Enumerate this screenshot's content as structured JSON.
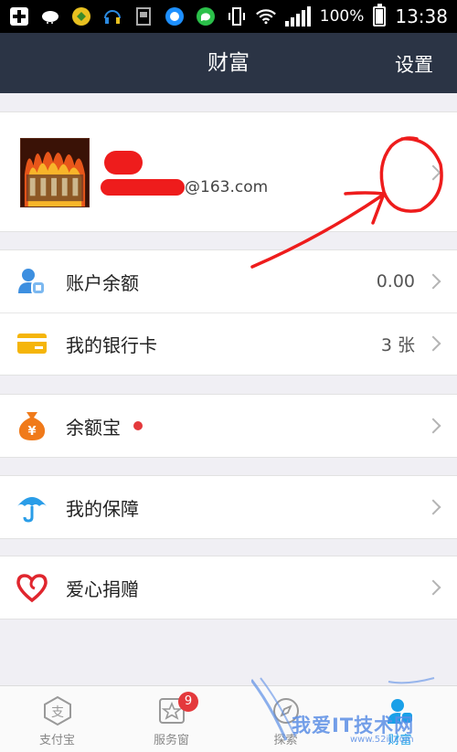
{
  "status_bar": {
    "battery": "100%",
    "time": "13:38",
    "icons": [
      "plus-icon",
      "cloud-icon",
      "shield-icon",
      "headset-icon",
      "sim-icon",
      "qq-browser-icon",
      "chat-icon",
      "vibrate-icon",
      "wifi-icon",
      "signal-icon",
      "battery-icon"
    ]
  },
  "header": {
    "title": "财富",
    "settings_label": "设置"
  },
  "profile": {
    "email_suffix": "@163.com"
  },
  "groups": [
    {
      "rows": [
        {
          "label": "账户余额",
          "value": "0.00",
          "icon": "account-balance-icon"
        },
        {
          "label": "我的银行卡",
          "value": "3 张",
          "icon": "bank-card-icon"
        }
      ]
    },
    {
      "rows": [
        {
          "label": "余额宝",
          "value": "",
          "icon": "money-bag-icon",
          "dot": true
        }
      ]
    },
    {
      "rows": [
        {
          "label": "我的保障",
          "value": "",
          "icon": "umbrella-icon"
        }
      ]
    },
    {
      "rows": [
        {
          "label": "爱心捐赠",
          "value": "",
          "icon": "heart-icon"
        }
      ]
    }
  ],
  "tabs": [
    {
      "label": "支付宝",
      "icon": "alipay-icon"
    },
    {
      "label": "服务窗",
      "icon": "service-window-icon",
      "badge": "9"
    },
    {
      "label": "探索",
      "icon": "explore-icon"
    },
    {
      "label": "财富",
      "icon": "wealth-icon"
    }
  ],
  "watermark": {
    "text": "我爱IT技术网",
    "url": "www.52ij.com"
  },
  "colors": {
    "header_bg": "#2b3445",
    "accent": "#1aa0e8",
    "annotation_red": "#ee1c1c",
    "badge_red": "#e4393c"
  }
}
